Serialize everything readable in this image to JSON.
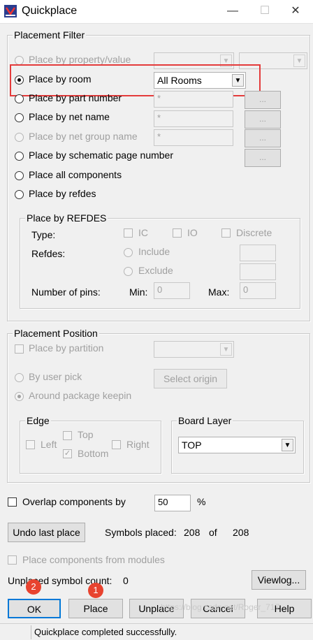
{
  "window": {
    "title": "Quickplace",
    "minimize": "—",
    "maximize": "☐",
    "close": "✕"
  },
  "placement_filter": {
    "legend": "Placement Filter",
    "options": [
      {
        "label": "Place by property/value",
        "enabled": false
      },
      {
        "label": "Place by room",
        "enabled": true,
        "selected": true
      },
      {
        "label": "Place by part number",
        "enabled": true
      },
      {
        "label": "Place by net name",
        "enabled": true
      },
      {
        "label": "Place by net group name",
        "enabled": false
      },
      {
        "label": "Place by schematic page number",
        "enabled": true
      },
      {
        "label": "Place all components",
        "enabled": true
      },
      {
        "label": "Place by refdes",
        "enabled": true
      }
    ],
    "room_value": "All Rooms",
    "part_number_value": "*",
    "net_name_value": "*",
    "net_group_value": "*",
    "browse_label": "...",
    "refdes_group": {
      "legend": "Place by REFDES",
      "type_label": "Type:",
      "types": [
        "IC",
        "IO",
        "Discrete"
      ],
      "refdes_label": "Refdes:",
      "include": "Include",
      "exclude": "Exclude",
      "pins_label": "Number of pins:",
      "min_label": "Min:",
      "min_value": "0",
      "max_label": "Max:",
      "max_value": "0"
    }
  },
  "placement_position": {
    "legend": "Placement Position",
    "by_partition": "Place by partition",
    "by_user_pick": "By user pick",
    "around_keepin": "Around package keepin",
    "select_origin": "Select origin",
    "edge": {
      "legend": "Edge",
      "top": "Top",
      "left": "Left",
      "right": "Right",
      "bottom": "Bottom"
    },
    "board_layer": {
      "legend": "Board Layer",
      "value": "TOP"
    }
  },
  "overlap": {
    "label": "Overlap components by",
    "value": "50",
    "unit": "%"
  },
  "undo_label": "Undo last place",
  "symbols": {
    "label": "Symbols placed:",
    "placed": "208",
    "of": "of",
    "total": "208"
  },
  "modules_label": "Place components from modules",
  "unplaced": {
    "label": "Unplaced symbol count:",
    "value": "0"
  },
  "viewlog_label": "Viewlog...",
  "buttons": {
    "ok": "OK",
    "place": "Place",
    "unplace": "Unplace",
    "cancel": "Cancel",
    "help": "Help"
  },
  "badges": {
    "ok": "2",
    "place": "1"
  },
  "status": "Quickplace completed successfully.",
  "watermark": "https://blog.csdn.net/Roger_717",
  "colors": {
    "highlight": "#e43b3b",
    "badge": "#e8432f"
  }
}
